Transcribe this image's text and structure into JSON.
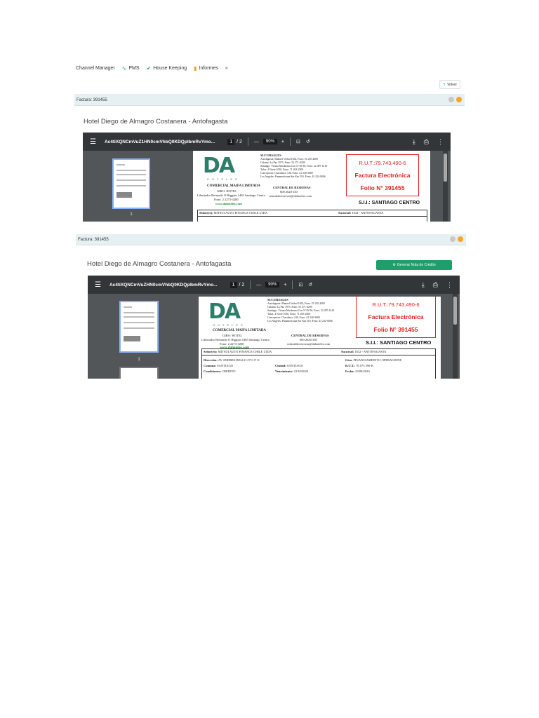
{
  "nav": {
    "items": [
      {
        "label": "Channel Manager",
        "icon": ""
      },
      {
        "label": "PMS",
        "icon": "chart-icon"
      },
      {
        "label": "House Keeping",
        "icon": "check-icon"
      },
      {
        "label": "Informes",
        "icon": "bar-chart-icon"
      }
    ],
    "more": "»"
  },
  "panel1": {
    "volver": "Volver",
    "factura": "Factura: 391455",
    "hotel": "Hotel Diego de Almagro Costanera - Antofagasta"
  },
  "panel2": {
    "factura": "Factura: 391455",
    "hotel": "Hotel Diego de Almagro Costanera - Antofagasta",
    "button": "Generar Nota de Crédito"
  },
  "viewer1": {
    "filename": "Ac4tiXQNCmVuZ1HN0cmVhbQ0KDQpIbmRvYmo...",
    "page": "1",
    "pages": "/ 2",
    "zoom": "90%",
    "thumb_number": "1"
  },
  "viewer2": {
    "filename": "Ac4tiXQNCmVuZHN0cmVhbQ0KDQpIbmRvYmo...",
    "page": "1",
    "pages": "/ 2",
    "zoom": "90%",
    "thumb_number": "1"
  },
  "invoice": {
    "logo": "DA",
    "hoteles": "HOTELES",
    "sucursales": "SUCURSALES",
    "branches": [
      "Antofagasta: Manuel Verbal 1632, Fono: 55 255 4400",
      "Calama: La Paz 1973, Fono: 55 271-4200",
      "Santiago: Vicuna Mackenna Con 5? Of 96, Fono: 22 497-1410",
      "Talca: 4 Norte 1050, Fono: 71 263-2500",
      "Concepcion: Chacabuco 136, Fono: 41 240-3600",
      "Los Angeles: Panamericana Sur Km 510, Fono: 43 232-0046"
    ],
    "company": "COMERCIAL MAIFA LIMITADA",
    "giro": "GIRO: HOTEL",
    "address": "Libertador Bernardo O Higgins 1465 Santiago Centro",
    "phone": "Fono: 2 2273-3200",
    "web": "www.dahoteles.com",
    "reservas_title": "CENTRAL DE RESERVAS",
    "reservas_phone": "600 2620 330",
    "reservas_email": "centraldereservas@dahoteles.com",
    "rut": "R.U.T.:79.743.490-6",
    "doc_type": "Factura Electrónica",
    "folio": "Folio N° 391455",
    "sii": "S.I.I.: SANTIAGO CENTRO",
    "senor_label": "Señor(es):",
    "senor_value": "MITSUI AUTO FINANCE CHILE LTDA",
    "sucursal_label": "Sucursal:",
    "sucursal_value": "1632 - ANTOFAGASTA",
    "direccion_label": "Dirección:",
    "direccion_value": "AV ANDRES BELLO 2711 P 11",
    "giro_label": "Giro:",
    "giro_value": "FINANCIAMIENTO OPERACIONE",
    "comuna_label": "Comuna:",
    "comuna_value": "SANTIAGO",
    "ciudad_label": "Ciudad:",
    "ciudad_value": "SANTIAGO",
    "rut_label": "R.U.T.:",
    "rut_value": "76 075 590-K",
    "condiciones_label": "Condiciones:",
    "condiciones_value": "CREDITO",
    "vencimiento_label": "Vencimiento:",
    "vencimiento_value": "23/10/2020",
    "fecha_label": "Fecha:",
    "fecha_value": "23/09/2020"
  },
  "colors": {
    "header_bg": "#e6eff1",
    "viewer_bar": "#323639",
    "viewer_bg": "#525659",
    "red": "#e02020",
    "green": "#1e9e6a"
  }
}
